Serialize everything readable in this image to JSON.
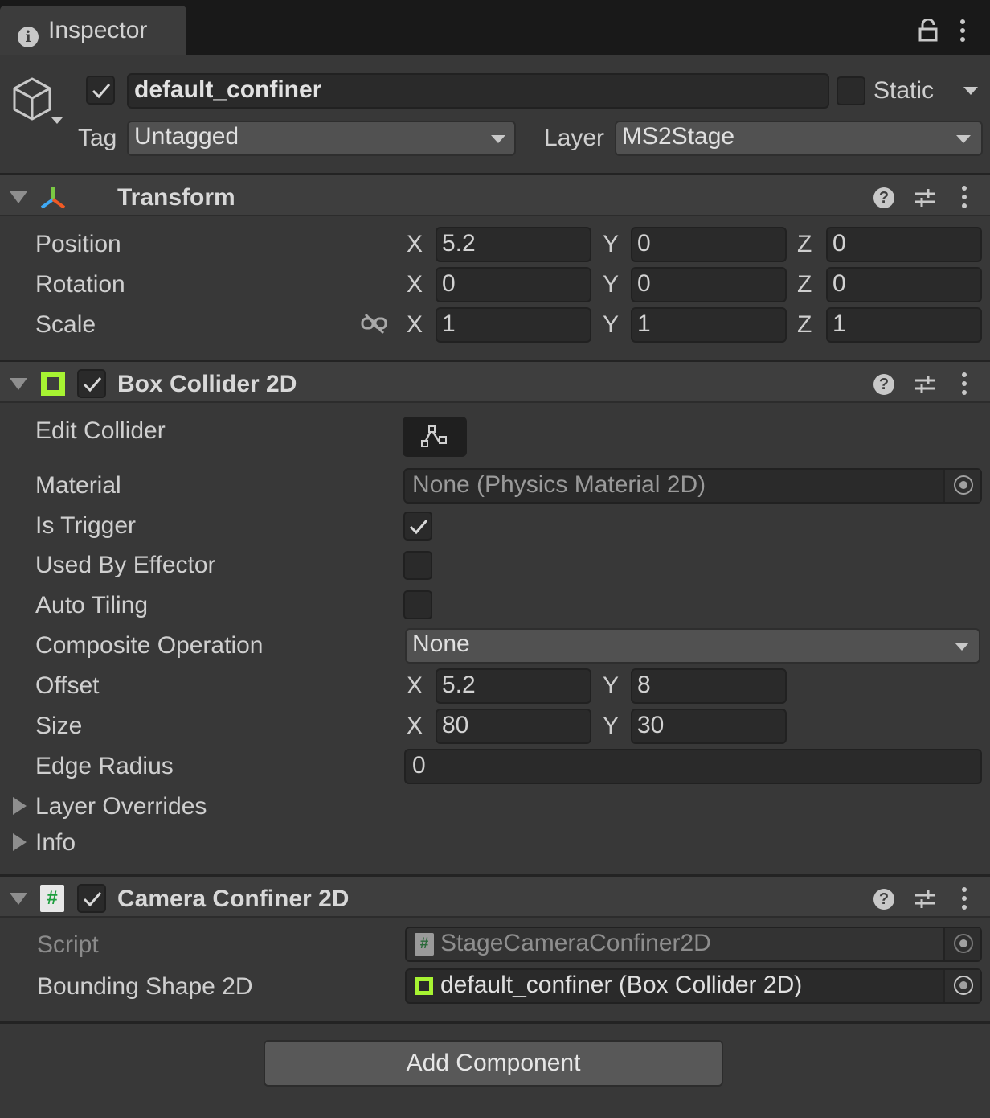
{
  "tab": {
    "title": "Inspector",
    "info_icon": "info-icon",
    "lock_icon": "lock-icon",
    "menu_icon": "kebab-menu-icon"
  },
  "gameobject": {
    "name": "default_confiner",
    "active": true,
    "static_label": "Static",
    "static": false,
    "tag_label": "Tag",
    "tag": "Untagged",
    "layer_label": "Layer",
    "layer": "MS2Stage"
  },
  "transform": {
    "title": "Transform",
    "position_label": "Position",
    "rotation_label": "Rotation",
    "scale_label": "Scale",
    "axis": {
      "x": "X",
      "y": "Y",
      "z": "Z"
    },
    "position": {
      "x": "5.2",
      "y": "0",
      "z": "0"
    },
    "rotation": {
      "x": "0",
      "y": "0",
      "z": "0"
    },
    "scale": {
      "x": "1",
      "y": "1",
      "z": "1"
    }
  },
  "box_collider": {
    "title": "Box Collider 2D",
    "enabled": true,
    "edit_collider_label": "Edit Collider",
    "material_label": "Material",
    "material_value": "None (Physics Material 2D)",
    "is_trigger_label": "Is Trigger",
    "is_trigger": true,
    "used_by_effector_label": "Used By Effector",
    "used_by_effector": false,
    "auto_tiling_label": "Auto Tiling",
    "auto_tiling": false,
    "composite_label": "Composite Operation",
    "composite_value": "None",
    "offset_label": "Offset",
    "offset": {
      "x": "5.2",
      "y": "8"
    },
    "size_label": "Size",
    "size": {
      "x": "80",
      "y": "30"
    },
    "edge_radius_label": "Edge Radius",
    "edge_radius": "0",
    "layer_overrides_label": "Layer Overrides",
    "info_label": "Info"
  },
  "camera_confiner": {
    "title": "Camera Confiner 2D",
    "enabled": true,
    "script_label": "Script",
    "script_value": "StageCameraConfiner2D",
    "bounding_label": "Bounding Shape 2D",
    "bounding_value": "default_confiner (Box Collider 2D)"
  },
  "add_component_label": "Add Component",
  "colors": {
    "collider_green": "#a7f432",
    "panel": "#383838",
    "header": "#3e3e3e",
    "field": "#2a2a2a"
  }
}
